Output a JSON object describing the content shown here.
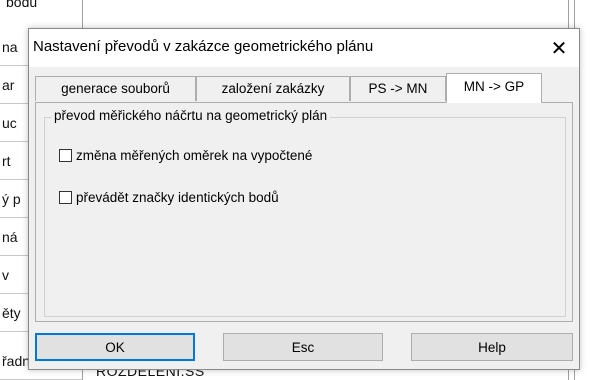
{
  "background": {
    "top_text": "bodů",
    "left_cells": [
      "na",
      "ar",
      "uc",
      "rt",
      "ý p",
      "ná",
      "v",
      "ěty",
      "řadnic"
    ],
    "bottom_text": "ROZDĚLENÍ.SS"
  },
  "dialog": {
    "title": "Nastavení převodů v zakázce geometrického plánu",
    "close_symbol": "✕",
    "tabs": [
      {
        "label": "generace souborů"
      },
      {
        "label": "založení zakázky"
      },
      {
        "label": "PS -> MN"
      },
      {
        "label": "MN -> GP",
        "active": true
      }
    ],
    "group": {
      "legend": "převod měřického náčrtu na geometrický plán",
      "options": [
        {
          "label": "změna měřených oměrek na vypočtené",
          "checked": false
        },
        {
          "label": "převádět značky identických bodů",
          "checked": false
        }
      ]
    },
    "buttons": {
      "ok": "OK",
      "esc": "Esc",
      "help": "Help"
    }
  },
  "colors": {
    "dialog_bg": "#f0f0f0",
    "default_button_border": "#0078d7"
  }
}
